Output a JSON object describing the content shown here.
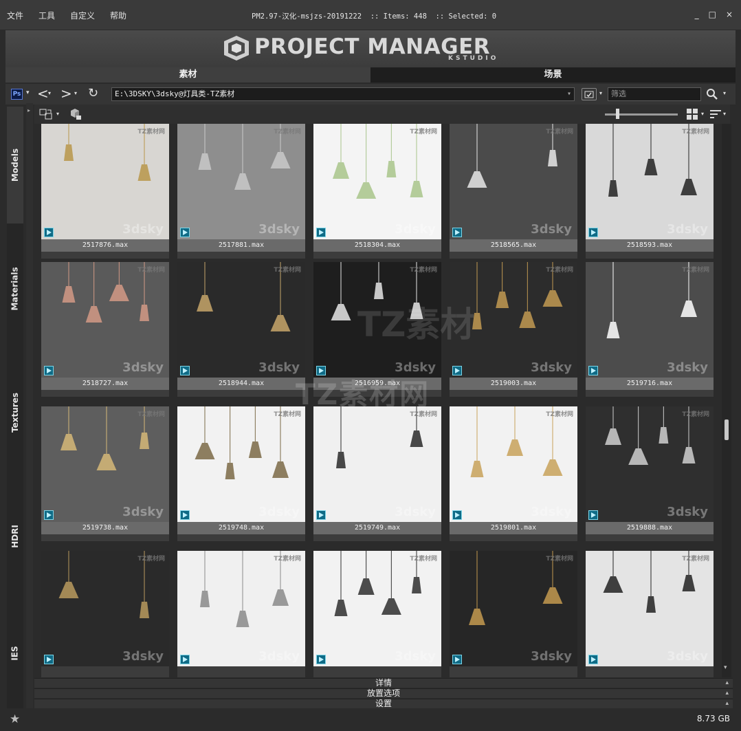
{
  "menu": [
    "文件",
    "工具",
    "自定义",
    "帮助"
  ],
  "window_title": "PM2.97-汉化-msjzs-20191222  :: Items: 448  :: Selected: 0",
  "window_buttons": [
    "_",
    "□",
    "×"
  ],
  "banner": {
    "title": "PROJECT MANAGER",
    "subtitle": "KSTUDIO"
  },
  "tabs": [
    {
      "label": "素材",
      "active": true
    },
    {
      "label": "场景",
      "active": false
    }
  ],
  "toolbar": {
    "ps_label": "Ps",
    "back_glyph": "<",
    "forward_glyph": ">",
    "refresh_glyph": "↻",
    "path": "E:\\3DSKY\\3dsky@灯具类-TZ素材",
    "filter_placeholder": "筛选"
  },
  "side_tabs": [
    {
      "label": "Models",
      "active": true
    },
    {
      "label": "Materials",
      "active": false
    },
    {
      "label": "Textures",
      "active": false
    },
    {
      "label": "HDRI",
      "active": false
    },
    {
      "label": "IES",
      "active": false
    }
  ],
  "watermarks": {
    "tz": "TZ素材网",
    "site": "3dsky",
    "big_cn": "TZ素材网",
    "big_mid": "TZ素材"
  },
  "items": [
    {
      "file": "2517876.max",
      "bg": "#d8d6d2",
      "accent": "#b8964a"
    },
    {
      "file": "2517881.max",
      "bg": "#8e8e8e",
      "accent": "#c9c9c9"
    },
    {
      "file": "2518304.max",
      "bg": "#f4f4f4",
      "accent": "#a8c48a"
    },
    {
      "file": "2518565.max",
      "bg": "#4b4b4b",
      "accent": "#e8e8e8"
    },
    {
      "file": "2518593.max",
      "bg": "#d9d9d9",
      "accent": "#222222"
    },
    {
      "file": "2518727.max",
      "bg": "#5a5a5a",
      "accent": "#d39a86"
    },
    {
      "file": "2518944.max",
      "bg": "#2a2a2a",
      "accent": "#c7a66a"
    },
    {
      "file": "2516959.max",
      "bg": "#1e1e1e",
      "accent": "#e6e6e6"
    },
    {
      "file": "2519003.max",
      "bg": "#2c2c2c",
      "accent": "#c29a52"
    },
    {
      "file": "2519716.max",
      "bg": "#4c4c4c",
      "accent": "#ffffff"
    },
    {
      "file": "2519738.max",
      "bg": "#5e5e5e",
      "accent": "#d6b878"
    },
    {
      "file": "2519748.max",
      "bg": "#f2f2f2",
      "accent": "#7b6a46"
    },
    {
      "file": "2519749.max",
      "bg": "#f0f0f0",
      "accent": "#2a2a2a"
    },
    {
      "file": "2519801.max",
      "bg": "#f2f2f2",
      "accent": "#c8a25a"
    },
    {
      "file": "2519888.max",
      "bg": "#2f2f2f",
      "accent": "#cfcfcf"
    },
    {
      "file": "",
      "bg": "#2a2a2a",
      "accent": "#b99a5e"
    },
    {
      "file": "",
      "bg": "#f0f0f0",
      "accent": "#8a8a8a"
    },
    {
      "file": "",
      "bg": "#f2f2f2",
      "accent": "#2f2f2f"
    },
    {
      "file": "",
      "bg": "#262626",
      "accent": "#c49a50"
    },
    {
      "file": "",
      "bg": "#e4e4e4",
      "accent": "#222222"
    }
  ],
  "bottom_panels": [
    "详情",
    "放置选项",
    "设置"
  ],
  "status": {
    "size": "8.73 GB"
  }
}
